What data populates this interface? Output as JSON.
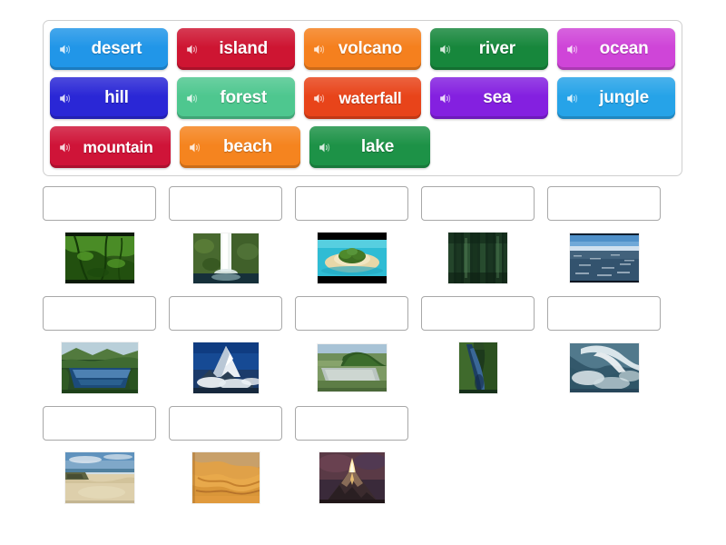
{
  "activity": {
    "type": "match-up",
    "word_bank": {
      "rows": [
        [
          {
            "label": "desert",
            "color": "#2196e8",
            "icon": "speaker-icon"
          },
          {
            "label": "island",
            "color": "#ce1532",
            "icon": "speaker-icon"
          },
          {
            "label": "volcano",
            "color": "#f5801e",
            "icon": "speaker-icon"
          },
          {
            "label": "river",
            "color": "#17873c",
            "icon": "speaker-icon"
          },
          {
            "label": "ocean",
            "color": "#cf45d8",
            "icon": "speaker-icon"
          }
        ],
        [
          {
            "label": "hill",
            "color": "#2a27d6",
            "icon": "speaker-icon"
          },
          {
            "label": "forest",
            "color": "#4ec78f",
            "icon": "speaker-icon"
          },
          {
            "label": "waterfall",
            "color": "#e8441a",
            "icon": "speaker-icon"
          },
          {
            "label": "sea",
            "color": "#8420e0",
            "icon": "speaker-icon"
          },
          {
            "label": "jungle",
            "color": "#26a3e8",
            "icon": "speaker-icon"
          }
        ],
        [
          {
            "label": "mountain",
            "color": "#cf1438",
            "icon": "speaker-icon"
          },
          {
            "label": "beach",
            "color": "#f5841f",
            "icon": "speaker-icon"
          },
          {
            "label": "lake",
            "color": "#1d9247",
            "icon": "speaker-icon"
          }
        ]
      ]
    },
    "answer_rows": [
      [
        {
          "dropzone_value": "",
          "image": "jungle-photo",
          "image_alt": "dense green jungle vines"
        },
        {
          "dropzone_value": "",
          "image": "waterfall-photo",
          "image_alt": "tall waterfall in green cliff"
        },
        {
          "dropzone_value": "",
          "image": "island-photo",
          "image_alt": "small tropical island with beach"
        },
        {
          "dropzone_value": "",
          "image": "forest-photo",
          "image_alt": "dark tall forest trees"
        },
        {
          "dropzone_value": "",
          "image": "ocean-photo",
          "image_alt": "open ocean under pale sky"
        }
      ],
      [
        {
          "dropzone_value": "",
          "image": "lake-photo",
          "image_alt": "lake between green hills"
        },
        {
          "dropzone_value": "",
          "image": "mountain-photo",
          "image_alt": "snowy mountain peak above clouds"
        },
        {
          "dropzone_value": "",
          "image": "hill-photo",
          "image_alt": "green hill beyond flat field"
        },
        {
          "dropzone_value": "",
          "image": "river-photo",
          "image_alt": "river winding through green valley"
        },
        {
          "dropzone_value": "",
          "image": "sea-photo",
          "image_alt": "large breaking sea wave"
        }
      ],
      [
        {
          "dropzone_value": "",
          "image": "beach-photo",
          "image_alt": "sandy beach with blue sky"
        },
        {
          "dropzone_value": "",
          "image": "desert-photo",
          "image_alt": "orange desert sand dunes"
        },
        {
          "dropzone_value": "",
          "image": "volcano-photo",
          "image_alt": "erupting volcano at dusk"
        }
      ]
    ]
  }
}
